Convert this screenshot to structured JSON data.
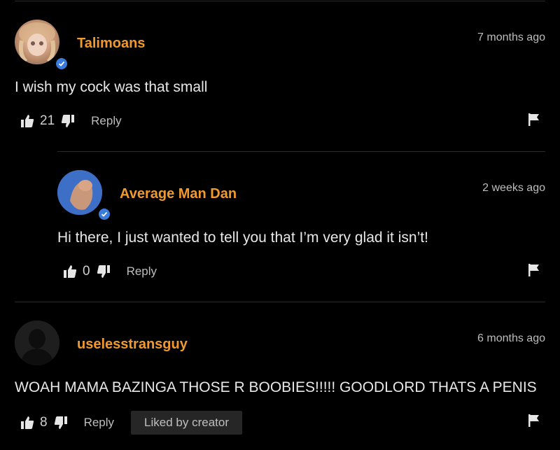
{
  "comments": [
    {
      "username": "Talimoans",
      "timestamp": "7 months ago",
      "text": "I wish my cock was that small",
      "likes": "21",
      "reply_label": "Reply",
      "verified": true,
      "avatar": "profile-photo"
    },
    {
      "username": "Average Man Dan",
      "timestamp": "2 weeks ago",
      "text": "Hi there, I just wanted to tell you that I’m very glad it isn’t!",
      "likes": "0",
      "reply_label": "Reply",
      "verified": true,
      "avatar": "profile-photo"
    },
    {
      "username": "uselesstransguy",
      "timestamp": "6 months ago",
      "text": "WOAH MAMA BAZINGA THOSE R BOOBIES!!!!! GOODLORD THATS A PENIS",
      "likes": "8",
      "reply_label": "Reply",
      "badge": "Liked by creator",
      "verified": false,
      "avatar": "default-silhouette"
    }
  ],
  "colors": {
    "background": "#000000",
    "username": "#f09a2e",
    "verified": "#3b7bdc",
    "divider": "#2a2a2a"
  },
  "icons": [
    "thumbs-up-icon",
    "thumbs-down-icon",
    "flag-icon",
    "verified-check-icon"
  ]
}
